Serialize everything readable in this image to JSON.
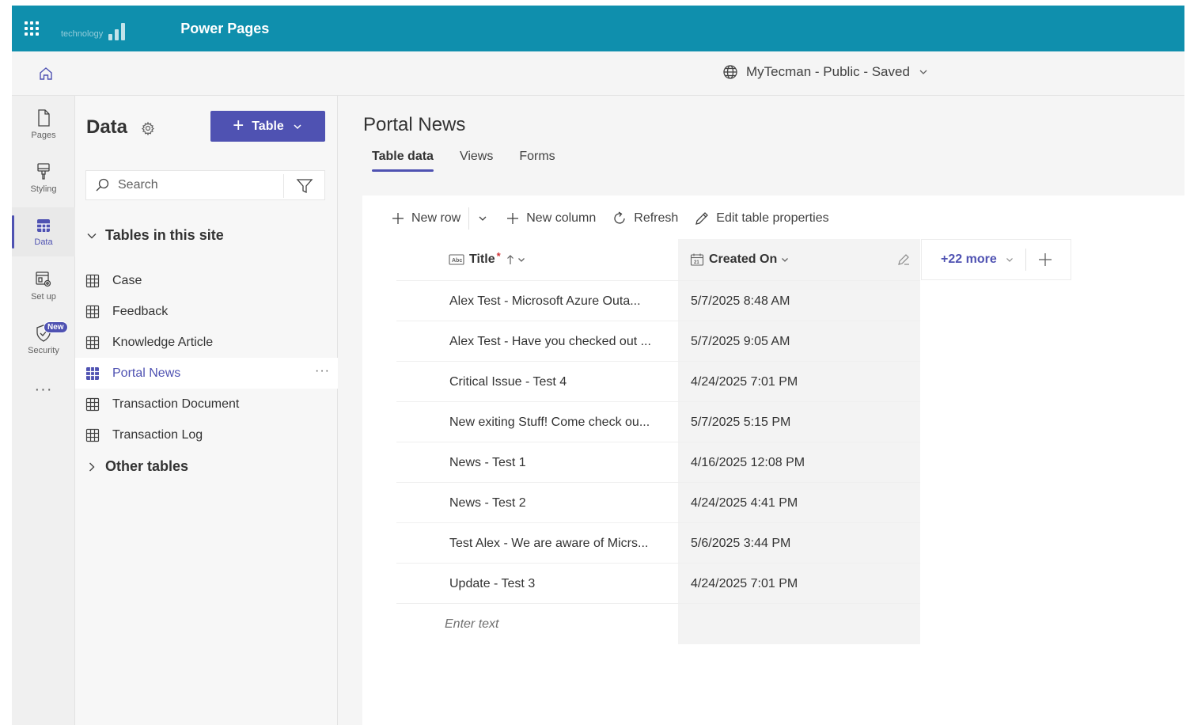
{
  "topbar": {
    "logo_text": "technology",
    "app_title": "Power Pages"
  },
  "subbar": {
    "site_status": "MyTecman - Public - Saved"
  },
  "rail": {
    "items": [
      {
        "label": "Pages",
        "icon": "page-icon"
      },
      {
        "label": "Styling",
        "icon": "paintbrush-icon"
      },
      {
        "label": "Data",
        "icon": "table-icon"
      },
      {
        "label": "Set up",
        "icon": "setup-icon"
      },
      {
        "label": "Security",
        "icon": "shield-icon"
      }
    ],
    "new_badge": "New",
    "more": "···"
  },
  "data_panel": {
    "title": "Data",
    "add_button": "Table",
    "search_placeholder": "Search",
    "section_site": "Tables in this site",
    "tables": [
      "Case",
      "Feedback",
      "Knowledge Article",
      "Portal News",
      "Transaction Document",
      "Transaction Log"
    ],
    "selected_table": "Portal News",
    "section_other": "Other tables",
    "more": "···"
  },
  "main": {
    "title": "Portal News",
    "tabs": [
      "Table data",
      "Views",
      "Forms"
    ],
    "active_tab": "Table data",
    "toolbar": {
      "new_row": "New row",
      "new_column": "New column",
      "refresh": "Refresh",
      "edit_properties": "Edit table properties"
    },
    "grid": {
      "columns": {
        "title": "Title",
        "required_mark": "*",
        "created_on": "Created On",
        "more": "+22 more"
      },
      "rows": [
        {
          "title": "Alex Test  - Microsoft Azure Outa...",
          "created_on": "5/7/2025 8:48 AM"
        },
        {
          "title": "Alex Test - Have you checked out ...",
          "created_on": "5/7/2025 9:05 AM"
        },
        {
          "title": "Critical Issue - Test 4",
          "created_on": "4/24/2025 7:01 PM"
        },
        {
          "title": "New exiting Stuff! Come check ou...",
          "created_on": "5/7/2025 5:15 PM"
        },
        {
          "title": "News - Test 1",
          "created_on": "4/16/2025 12:08 PM"
        },
        {
          "title": "News - Test 2",
          "created_on": "4/24/2025 4:41 PM"
        },
        {
          "title": "Test Alex - We are aware of Micrs...",
          "created_on": "5/6/2025 3:44 PM"
        },
        {
          "title": "Update - Test 3",
          "created_on": "4/24/2025 7:01 PM"
        }
      ],
      "new_row_placeholder": "Enter text"
    }
  },
  "colors": {
    "topbar": "#0f8fad",
    "accent": "#4f52b2"
  }
}
